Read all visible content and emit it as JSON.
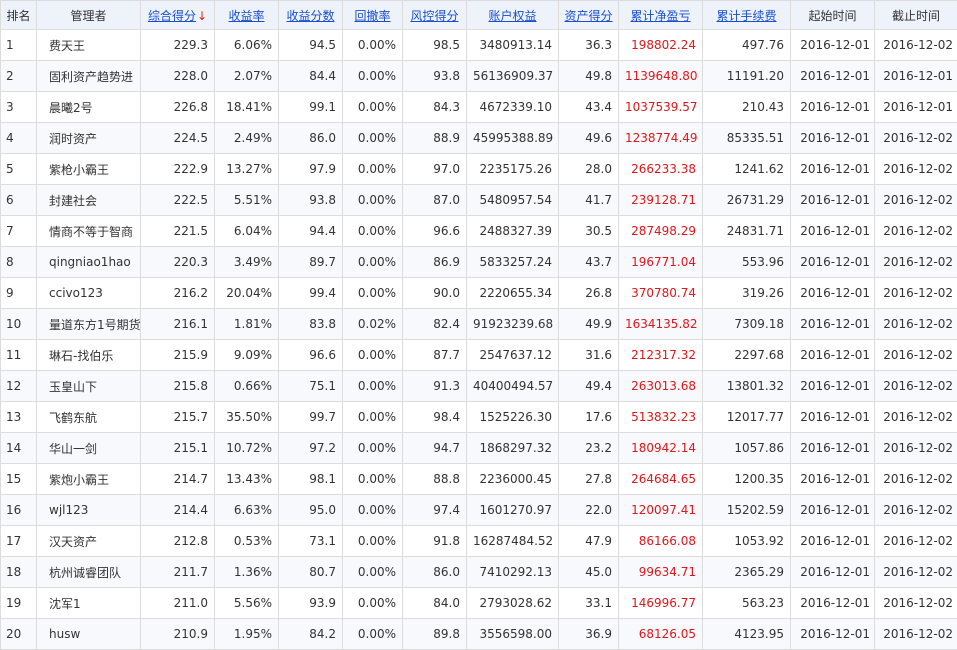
{
  "columns": {
    "rank": "排名",
    "manager": "管理者",
    "composite_score": "综合得分",
    "return_rate": "收益率",
    "return_score": "收益分数",
    "drawdown": "回撤率",
    "risk_score": "风控得分",
    "equity": "账户权益",
    "asset_score": "资产得分",
    "cum_pnl": "累计净盈亏",
    "cum_fee": "累计手续费",
    "start_date": "起始时间",
    "end_date": "截止时间",
    "sort_icon": "↓"
  },
  "colors": {
    "header_bg": "#eef3fb",
    "link": "#1a4fd1",
    "profit": "#e0161b",
    "sort_arrow": "#e02020"
  },
  "rows": [
    {
      "rank": "1",
      "name": "费天王",
      "composite": "229.3",
      "return_rate": "6.06%",
      "return_score": "94.5",
      "drawdown": "0.00%",
      "risk": "98.5",
      "equity": "3480913.14",
      "asset": "36.3",
      "pnl": "198802.24",
      "fee": "497.76",
      "start": "2016-12-01",
      "end": "2016-12-02"
    },
    {
      "rank": "2",
      "name": "固利资产趋势进",
      "composite": "228.0",
      "return_rate": "2.07%",
      "return_score": "84.4",
      "drawdown": "0.00%",
      "risk": "93.8",
      "equity": "56136909.37",
      "asset": "49.8",
      "pnl": "1139648.80",
      "fee": "11191.20",
      "start": "2016-12-01",
      "end": "2016-12-01"
    },
    {
      "rank": "3",
      "name": "晨曦2号",
      "composite": "226.8",
      "return_rate": "18.41%",
      "return_score": "99.1",
      "drawdown": "0.00%",
      "risk": "84.3",
      "equity": "4672339.10",
      "asset": "43.4",
      "pnl": "1037539.57",
      "fee": "210.43",
      "start": "2016-12-01",
      "end": "2016-12-01"
    },
    {
      "rank": "4",
      "name": "润时资产",
      "composite": "224.5",
      "return_rate": "2.49%",
      "return_score": "86.0",
      "drawdown": "0.00%",
      "risk": "88.9",
      "equity": "45995388.89",
      "asset": "49.6",
      "pnl": "1238774.49",
      "fee": "85335.51",
      "start": "2016-12-01",
      "end": "2016-12-02"
    },
    {
      "rank": "5",
      "name": "紫枪小霸王",
      "composite": "222.9",
      "return_rate": "13.27%",
      "return_score": "97.9",
      "drawdown": "0.00%",
      "risk": "97.0",
      "equity": "2235175.26",
      "asset": "28.0",
      "pnl": "266233.38",
      "fee": "1241.62",
      "start": "2016-12-01",
      "end": "2016-12-02"
    },
    {
      "rank": "6",
      "name": "封建社会",
      "composite": "222.5",
      "return_rate": "5.51%",
      "return_score": "93.8",
      "drawdown": "0.00%",
      "risk": "87.0",
      "equity": "5480957.54",
      "asset": "41.7",
      "pnl": "239128.71",
      "fee": "26731.29",
      "start": "2016-12-01",
      "end": "2016-12-02"
    },
    {
      "rank": "7",
      "name": "情商不等于智商",
      "composite": "221.5",
      "return_rate": "6.04%",
      "return_score": "94.4",
      "drawdown": "0.00%",
      "risk": "96.6",
      "equity": "2488327.39",
      "asset": "30.5",
      "pnl": "287498.29",
      "fee": "24831.71",
      "start": "2016-12-01",
      "end": "2016-12-02"
    },
    {
      "rank": "8",
      "name": "qingniao1hao",
      "composite": "220.3",
      "return_rate": "3.49%",
      "return_score": "89.7",
      "drawdown": "0.00%",
      "risk": "86.9",
      "equity": "5833257.24",
      "asset": "43.7",
      "pnl": "196771.04",
      "fee": "553.96",
      "start": "2016-12-01",
      "end": "2016-12-02"
    },
    {
      "rank": "9",
      "name": "ccivo123",
      "composite": "216.2",
      "return_rate": "20.04%",
      "return_score": "99.4",
      "drawdown": "0.00%",
      "risk": "90.0",
      "equity": "2220655.34",
      "asset": "26.8",
      "pnl": "370780.74",
      "fee": "319.26",
      "start": "2016-12-01",
      "end": "2016-12-02"
    },
    {
      "rank": "10",
      "name": "量道东方1号期货",
      "composite": "216.1",
      "return_rate": "1.81%",
      "return_score": "83.8",
      "drawdown": "0.02%",
      "risk": "82.4",
      "equity": "91923239.68",
      "asset": "49.9",
      "pnl": "1634135.82",
      "fee": "7309.18",
      "start": "2016-12-01",
      "end": "2016-12-02"
    },
    {
      "rank": "11",
      "name": "琳石-找伯乐",
      "composite": "215.9",
      "return_rate": "9.09%",
      "return_score": "96.6",
      "drawdown": "0.00%",
      "risk": "87.7",
      "equity": "2547637.12",
      "asset": "31.6",
      "pnl": "212317.32",
      "fee": "2297.68",
      "start": "2016-12-01",
      "end": "2016-12-02"
    },
    {
      "rank": "12",
      "name": "玉皇山下",
      "composite": "215.8",
      "return_rate": "0.66%",
      "return_score": "75.1",
      "drawdown": "0.00%",
      "risk": "91.3",
      "equity": "40400494.57",
      "asset": "49.4",
      "pnl": "263013.68",
      "fee": "13801.32",
      "start": "2016-12-01",
      "end": "2016-12-02"
    },
    {
      "rank": "13",
      "name": "飞鹤东航",
      "composite": "215.7",
      "return_rate": "35.50%",
      "return_score": "99.7",
      "drawdown": "0.00%",
      "risk": "98.4",
      "equity": "1525226.30",
      "asset": "17.6",
      "pnl": "513832.23",
      "fee": "12017.77",
      "start": "2016-12-01",
      "end": "2016-12-02"
    },
    {
      "rank": "14",
      "name": "华山一剑",
      "composite": "215.1",
      "return_rate": "10.72%",
      "return_score": "97.2",
      "drawdown": "0.00%",
      "risk": "94.7",
      "equity": "1868297.32",
      "asset": "23.2",
      "pnl": "180942.14",
      "fee": "1057.86",
      "start": "2016-12-01",
      "end": "2016-12-02"
    },
    {
      "rank": "15",
      "name": "紫炮小霸王",
      "composite": "214.7",
      "return_rate": "13.43%",
      "return_score": "98.1",
      "drawdown": "0.00%",
      "risk": "88.8",
      "equity": "2236000.45",
      "asset": "27.8",
      "pnl": "264684.65",
      "fee": "1200.35",
      "start": "2016-12-01",
      "end": "2016-12-02"
    },
    {
      "rank": "16",
      "name": "wjl123",
      "composite": "214.4",
      "return_rate": "6.63%",
      "return_score": "95.0",
      "drawdown": "0.00%",
      "risk": "97.4",
      "equity": "1601270.97",
      "asset": "22.0",
      "pnl": "120097.41",
      "fee": "15202.59",
      "start": "2016-12-01",
      "end": "2016-12-02"
    },
    {
      "rank": "17",
      "name": "汉天资产",
      "composite": "212.8",
      "return_rate": "0.53%",
      "return_score": "73.1",
      "drawdown": "0.00%",
      "risk": "91.8",
      "equity": "16287484.52",
      "asset": "47.9",
      "pnl": "86166.08",
      "fee": "1053.92",
      "start": "2016-12-01",
      "end": "2016-12-02"
    },
    {
      "rank": "18",
      "name": "杭州诚睿团队",
      "composite": "211.7",
      "return_rate": "1.36%",
      "return_score": "80.7",
      "drawdown": "0.00%",
      "risk": "86.0",
      "equity": "7410292.13",
      "asset": "45.0",
      "pnl": "99634.71",
      "fee": "2365.29",
      "start": "2016-12-01",
      "end": "2016-12-02"
    },
    {
      "rank": "19",
      "name": "沈军1",
      "composite": "211.0",
      "return_rate": "5.56%",
      "return_score": "93.9",
      "drawdown": "0.00%",
      "risk": "84.0",
      "equity": "2793028.62",
      "asset": "33.1",
      "pnl": "146996.77",
      "fee": "563.23",
      "start": "2016-12-01",
      "end": "2016-12-02"
    },
    {
      "rank": "20",
      "name": "husw",
      "composite": "210.9",
      "return_rate": "1.95%",
      "return_score": "84.2",
      "drawdown": "0.00%",
      "risk": "89.8",
      "equity": "3556598.00",
      "asset": "36.9",
      "pnl": "68126.05",
      "fee": "4123.95",
      "start": "2016-12-01",
      "end": "2016-12-02"
    }
  ]
}
